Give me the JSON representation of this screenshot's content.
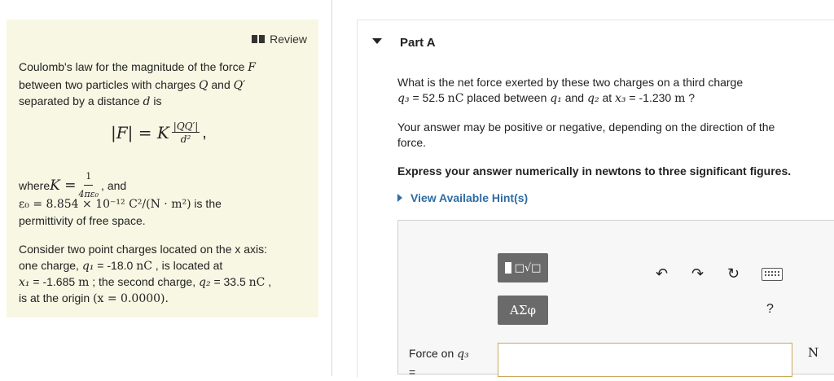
{
  "review": {
    "label": "Review"
  },
  "intro": {
    "line1a": "Coulomb's law for the magnitude of the force ",
    "line1b": "F",
    "line2a": "between two particles with charges ",
    "line2b": "Q",
    "line2c": " and ",
    "line2d": "Q′",
    "line3a": "separated by a distance ",
    "line3b": "d",
    "line3c": " is"
  },
  "formula": {
    "lhs": "|F| = K",
    "num": "|QQ′|",
    "den": "d²",
    "tail": ","
  },
  "where": {
    "prefix": "where ",
    "k": "K = ",
    "knum": "1",
    "kden": "4πε₀",
    "suffix": ", and",
    "eps": "ε₀ = 8.854 × 10⁻¹² C²/(N · m²)",
    "eps_suffix": " is the",
    "perm": "permittivity of free space."
  },
  "consider": {
    "l1": "Consider two point charges located on the x axis:",
    "l2a": "one charge, ",
    "l2b": "q₁",
    "l2c": " = -18.0 ",
    "l2d": "nC",
    "l2e": " , is located at",
    "l3a": "x₁",
    "l3b": " = -1.685 ",
    "l3c": "m",
    "l3d": " ; the second charge, ",
    "l3e": "q₂",
    "l3f": " = 33.5 ",
    "l3g": "nC",
    "l3h": " ,",
    "l4a": "is at the origin ",
    "l4b": "(x = 0.0000)."
  },
  "part": {
    "title": "Part A"
  },
  "question": {
    "l1": "What is the net force exerted by these two charges on a third charge",
    "l2a": "q₃",
    "l2b": " = 52.5 ",
    "l2c": "nC",
    "l2d": " placed between ",
    "l2e": "q₁",
    "l2f": " and ",
    "l2g": "q₂",
    "l2h": " at ",
    "l2i": "x₃",
    "l2j": " = -1.230 ",
    "l2k": "m",
    "l2l": " ?"
  },
  "note": {
    "l1": "Your answer may be positive or negative, depending on the direction of the",
    "l2": "force."
  },
  "instruction": "Express your answer numerically in newtons to three significant figures.",
  "hints": {
    "label": "View Available Hint(s)"
  },
  "toolbar": {
    "templates_glyphs": "□√□",
    "symbols_label": "ΑΣφ",
    "undo": "↶",
    "redo": "↷",
    "reset": "↻",
    "help": "?"
  },
  "answer": {
    "label_a": "Force on ",
    "label_b": "q₃",
    "label_c": "=",
    "value": "",
    "unit": "N"
  }
}
